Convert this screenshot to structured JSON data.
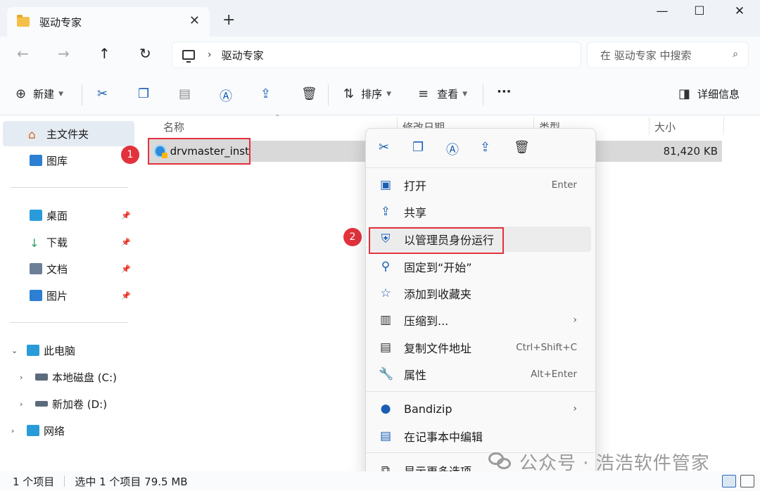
{
  "window": {
    "tab_title": "驱动专家",
    "tab_close": "✕",
    "new_tab": "+",
    "minimize": "—",
    "maximize": "☐",
    "close": "✕"
  },
  "nav": {
    "back_icon": "arrow-left-icon",
    "forward_icon": "arrow-right-icon",
    "up_icon": "arrow-up-icon",
    "refresh_icon": "refresh-icon",
    "breadcrumb": "驱动专家",
    "search_placeholder": "在 驱动专家 中搜索"
  },
  "toolbar": {
    "new_label": "新建",
    "sort_label": "排序",
    "view_label": "查看",
    "more_label": "···",
    "details_label": "详细信息"
  },
  "sidebar": {
    "home": "主文件夹",
    "gallery": "图库",
    "pinned": [
      {
        "label": "桌面",
        "icon": "desktop-icon"
      },
      {
        "label": "下载",
        "icon": "download-icon"
      },
      {
        "label": "文档",
        "icon": "document-icon"
      },
      {
        "label": "图片",
        "icon": "pictures-icon"
      }
    ],
    "this_pc": "此电脑",
    "drives": [
      {
        "label": "本地磁盘 (C:)"
      },
      {
        "label": "新加卷 (D:)"
      }
    ],
    "network": "网络"
  },
  "columns": {
    "name": "名称",
    "date": "修改日期",
    "type": "类型",
    "size": "大小"
  },
  "file": {
    "name": "drvmaster_inst",
    "size": "81,420 KB"
  },
  "markers": {
    "one": "1",
    "two": "2"
  },
  "context_menu": {
    "items": [
      {
        "label": "打开",
        "shortcut": "Enter",
        "icon": "open-icon"
      },
      {
        "label": "共享",
        "shortcut": "",
        "icon": "share-icon"
      },
      {
        "label": "以管理员身份运行",
        "shortcut": "",
        "icon": "shield-icon"
      },
      {
        "label": "固定到“开始”",
        "shortcut": "",
        "icon": "pin-icon"
      },
      {
        "label": "添加到收藏夹",
        "shortcut": "",
        "icon": "star-icon"
      },
      {
        "label": "压缩到...",
        "shortcut": "",
        "icon": "zip-icon"
      },
      {
        "label": "复制文件地址",
        "shortcut": "Ctrl+Shift+C",
        "icon": "copy-path-icon"
      },
      {
        "label": "属性",
        "shortcut": "Alt+Enter",
        "icon": "wrench-icon"
      },
      {
        "label": "Bandizip",
        "shortcut": "",
        "icon": "bandizip-icon"
      },
      {
        "label": "在记事本中编辑",
        "shortcut": "",
        "icon": "notepad-icon"
      },
      {
        "label": "显示更多选项",
        "shortcut": "",
        "icon": "more-options-icon"
      }
    ]
  },
  "status": {
    "count": "1 个项目",
    "selected": "选中 1 个项目 79.5 MB"
  },
  "watermark": "公众号 · 浩浩软件管家",
  "colors": {
    "accent": "#1a5fb4",
    "highlight_red": "#e2323c",
    "selection": "#d9d9d9"
  }
}
